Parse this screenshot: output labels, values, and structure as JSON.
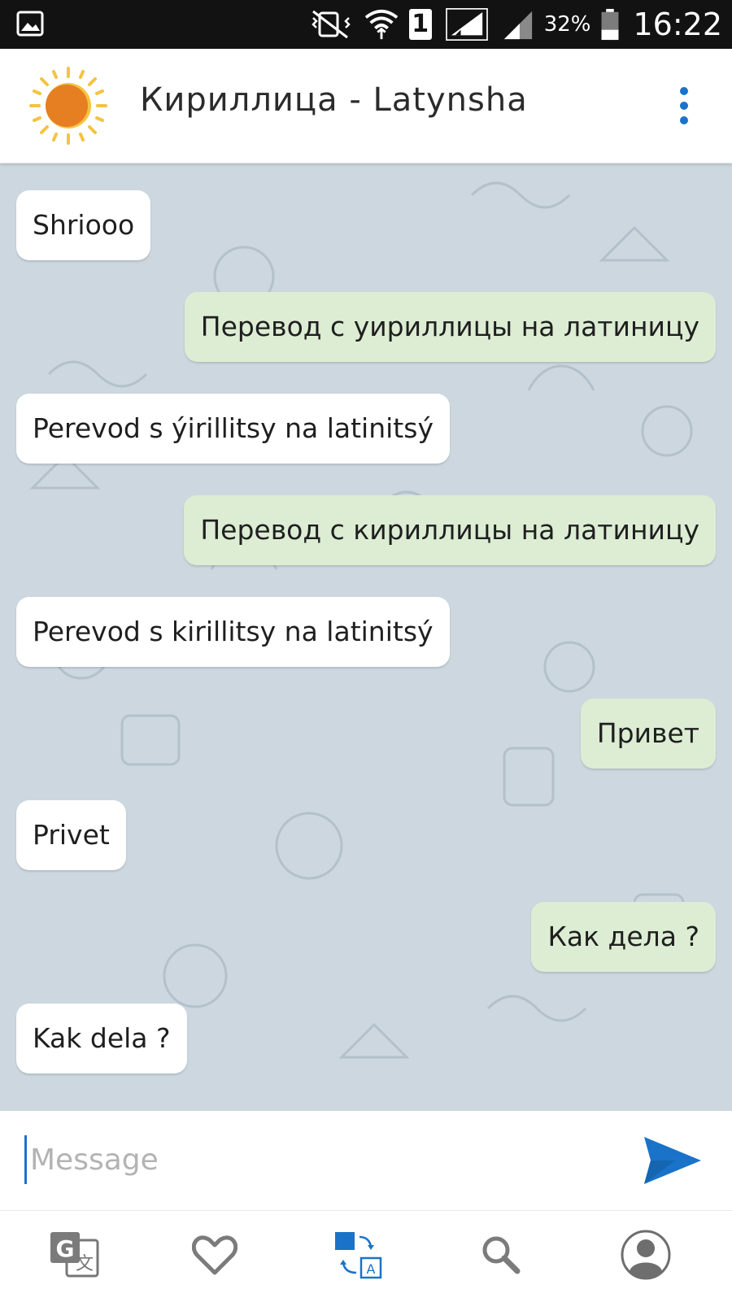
{
  "status_bar": {
    "battery_percent": "32%",
    "time": "16:22",
    "sim_slot": "1"
  },
  "header": {
    "title": "Кириллица - Latynsha",
    "logo_icon": "sun-icon",
    "menu_icon": "more-vert-icon"
  },
  "messages": [
    {
      "side": "in",
      "text": "Shriooo"
    },
    {
      "side": "out",
      "text": "Перевод с уириллицы на латиницу"
    },
    {
      "side": "in",
      "text": "Perevod s ýirillitsy na latinitsý"
    },
    {
      "side": "out",
      "text": "Перевод с кириллицы на латиницу"
    },
    {
      "side": "in",
      "text": "Perevod s kirillitsy na latinitsý"
    },
    {
      "side": "out",
      "text": "Привет"
    },
    {
      "side": "in",
      "text": "Privet"
    },
    {
      "side": "out",
      "text": "Как дела ?"
    },
    {
      "side": "in",
      "text": "Kak dela ?"
    }
  ],
  "input": {
    "placeholder": "Message",
    "value": "",
    "send_icon": "send-icon"
  },
  "bottom_nav": [
    {
      "name": "google-translate-icon",
      "active": false
    },
    {
      "name": "heart-icon",
      "active": false
    },
    {
      "name": "transliterate-icon",
      "active": true
    },
    {
      "name": "search-icon",
      "active": false
    },
    {
      "name": "account-icon",
      "active": false
    }
  ],
  "colors": {
    "accent": "#1a73c8",
    "incoming_bubble": "#ffffff",
    "outgoing_bubble": "#dcedd3",
    "chat_background": "#ccd7df",
    "logo_sun": "#e67e22",
    "logo_rays": "#f5c342"
  }
}
